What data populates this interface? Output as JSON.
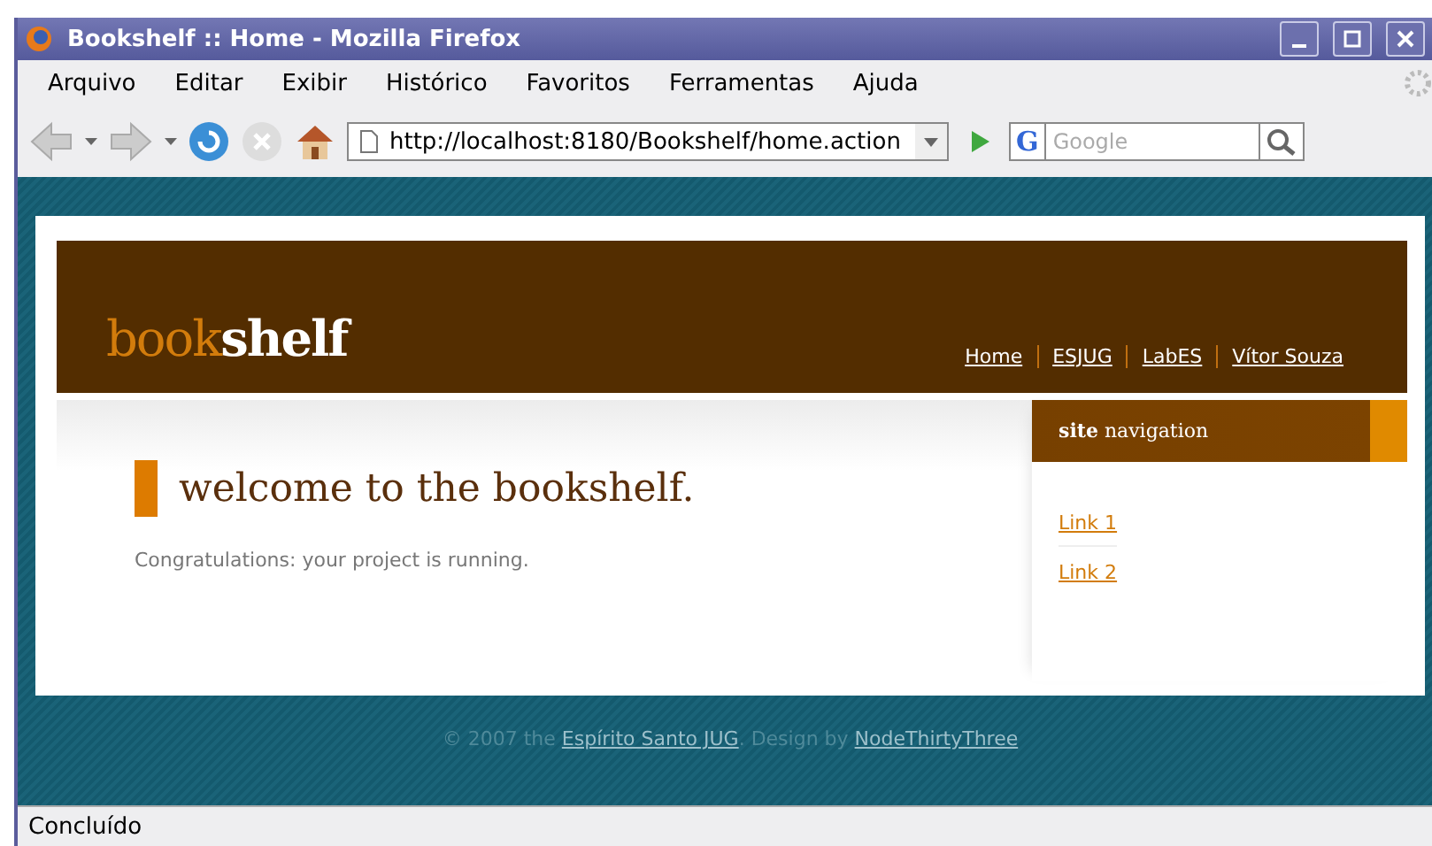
{
  "window": {
    "title": "Bookshelf :: Home - Mozilla Firefox"
  },
  "menu": [
    "Arquivo",
    "Editar",
    "Exibir",
    "Histórico",
    "Favoritos",
    "Ferramentas",
    "Ajuda"
  ],
  "toolbar": {
    "url": "http://localhost:8180/Bookshelf/home.action",
    "search_engine": "G",
    "search": {
      "placeholder": "Google"
    }
  },
  "page": {
    "logo": {
      "light": "book",
      "bold": "shelf"
    },
    "top_nav": [
      "Home",
      "ESJUG",
      "LabES",
      "Vítor Souza"
    ],
    "heading": "welcome to the bookshelf.",
    "message": "Congratulations: your project is running.",
    "sidebar": {
      "title_bold": "site",
      "title": "navigation",
      "links": [
        "Link 1",
        "Link 2"
      ]
    },
    "footer": [
      {
        "kind": "text",
        "text": "© 2007 the "
      },
      {
        "kind": "link",
        "text": "Espírito Santo JUG"
      },
      {
        "kind": "text",
        "text": ". Design by "
      },
      {
        "kind": "link",
        "text": "NodeThirtyThree"
      }
    ]
  },
  "status_bar": "Concluído"
}
